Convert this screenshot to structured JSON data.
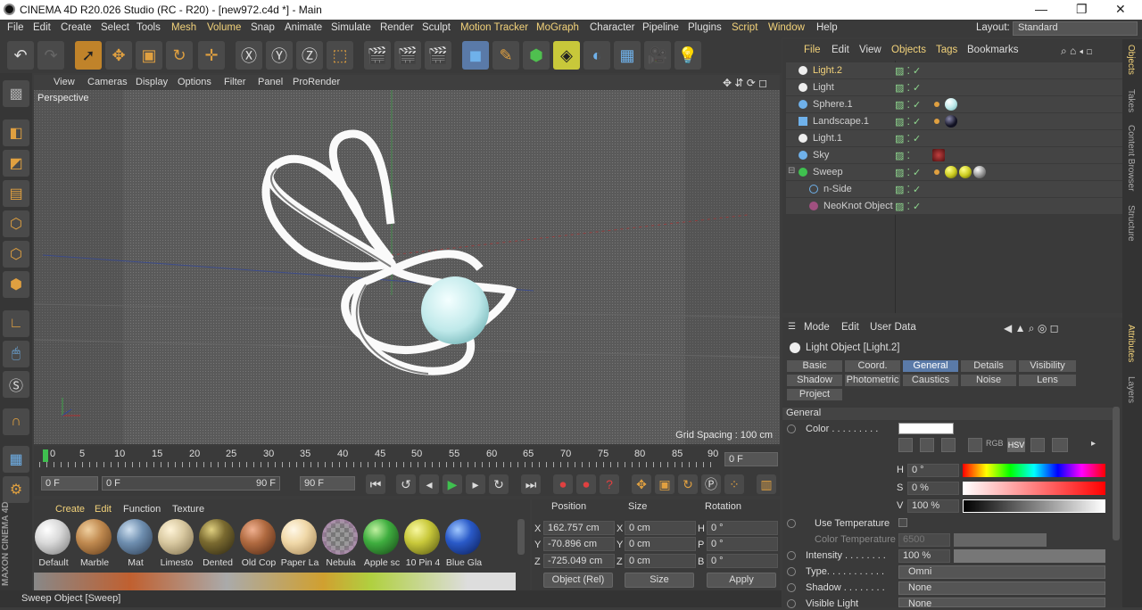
{
  "window": {
    "title": "CINEMA 4D R20.026 Studio (RC - R20) - [new972.c4d *] - Main"
  },
  "menubar": {
    "items": [
      "File",
      "Edit",
      "Create",
      "Select",
      "Tools",
      "Mesh",
      "Volume",
      "Snap",
      "Animate",
      "Simulate",
      "Render",
      "Sculpt",
      "Motion Tracker",
      "MoGraph",
      "Character",
      "Pipeline",
      "Plugins",
      "Script",
      "Window",
      "Help"
    ],
    "layout_label": "Layout:",
    "layout_value": "Standard"
  },
  "viewport": {
    "menu": [
      "View",
      "Cameras",
      "Display",
      "Options",
      "Filter",
      "Panel",
      "ProRender"
    ],
    "camera_label": "Perspective",
    "grid_spacing": "Grid Spacing : 100 cm"
  },
  "timeline": {
    "ticks": [
      "0",
      "5",
      "10",
      "15",
      "20",
      "25",
      "30",
      "35",
      "40",
      "45",
      "50",
      "55",
      "60",
      "65",
      "70",
      "75",
      "80",
      "85",
      "90"
    ],
    "current_frame": "0 F",
    "start": "0 F",
    "range_start": "0 F",
    "range_end": "90 F",
    "end": "90 F"
  },
  "materials": {
    "menu": [
      "Create",
      "Edit",
      "Function",
      "Texture"
    ],
    "items": [
      {
        "name": "Default",
        "color": "#d9d9d9"
      },
      {
        "name": "Marble",
        "color": "#c08a50"
      },
      {
        "name": "Mat",
        "color": "#6f8fb0"
      },
      {
        "name": "Limesto",
        "color": "#d8c8a0"
      },
      {
        "name": "Dented",
        "color": "#7a6a30"
      },
      {
        "name": "Old Cop",
        "color": "#b06a40"
      },
      {
        "name": "Paper La",
        "color": "#f0d8a8"
      },
      {
        "name": "Nebula",
        "color": "#9a7aa0"
      },
      {
        "name": "Apple sc",
        "color": "#3fae3f"
      },
      {
        "name": "10 Pin 4",
        "color": "#c8c83a"
      },
      {
        "name": "Blue Gla",
        "color": "#2a5ac8"
      }
    ]
  },
  "coordinates": {
    "headers": [
      "Position",
      "Size",
      "Rotation"
    ],
    "position": {
      "x": "162.757 cm",
      "y": "-70.896 cm",
      "z": "-725.049 cm"
    },
    "size": {
      "x": "0 cm",
      "y": "0 cm",
      "z": "0 cm"
    },
    "rotation": {
      "h": "0 °",
      "p": "0 °",
      "b": "0 °"
    },
    "mode": "Object (Rel)",
    "size_mode": "Size",
    "apply": "Apply"
  },
  "status": "Sweep Object [Sweep]",
  "object_manager": {
    "menu": [
      "File",
      "Edit",
      "View",
      "Objects",
      "Tags",
      "Bookmarks"
    ],
    "objects": [
      {
        "name": "Light.2",
        "icon": "light-icon",
        "selected": true
      },
      {
        "name": "Light",
        "icon": "light-icon",
        "selected": false
      },
      {
        "name": "Sphere.1",
        "icon": "sphere-icon",
        "selected": false
      },
      {
        "name": "Landscape.1",
        "icon": "landscape-icon",
        "selected": false
      },
      {
        "name": "Light.1",
        "icon": "light-icon",
        "selected": false
      },
      {
        "name": "Sky",
        "icon": "sky-icon",
        "selected": false
      },
      {
        "name": "Sweep",
        "icon": "sweep-icon",
        "selected": false
      },
      {
        "name": "n-Side",
        "icon": "nside-icon",
        "selected": false
      },
      {
        "name": "NeoKnot Object",
        "icon": "knot-icon",
        "selected": false
      }
    ]
  },
  "right_tabs": [
    "Objects",
    "Takes",
    "Content Browser",
    "Structure",
    "Attributes",
    "Layers"
  ],
  "attribute_manager": {
    "menu": [
      "Mode",
      "Edit",
      "User Data"
    ],
    "object_name": "Light Object [Light.2]",
    "tabs": [
      "Basic",
      "Coord.",
      "General",
      "Details",
      "Visibility",
      "Shadow",
      "Photometric",
      "Caustics",
      "Noise",
      "Lens",
      "Project"
    ],
    "active_tab": "General",
    "section": "General",
    "color_label": "Color . . . . . . . . .",
    "color_modes": [
      "RGB",
      "HSV"
    ],
    "h_label": "H",
    "h_value": "0 °",
    "s_label": "S",
    "s_value": "0 %",
    "v_label": "V",
    "v_value": "100 %",
    "use_temperature": "Use Temperature",
    "color_temperature": "Color Temperature",
    "color_temperature_value": "6500",
    "intensity_label": "Intensity . . . . . . . .",
    "intensity_value": "100 %",
    "type_label": "Type. . . . . . . . . . .",
    "type_value": "Omni",
    "shadow_label": "Shadow . . . . . . . .",
    "shadow_value": "None",
    "visible_light_label": "Visible Light",
    "visible_light_value": "None"
  }
}
